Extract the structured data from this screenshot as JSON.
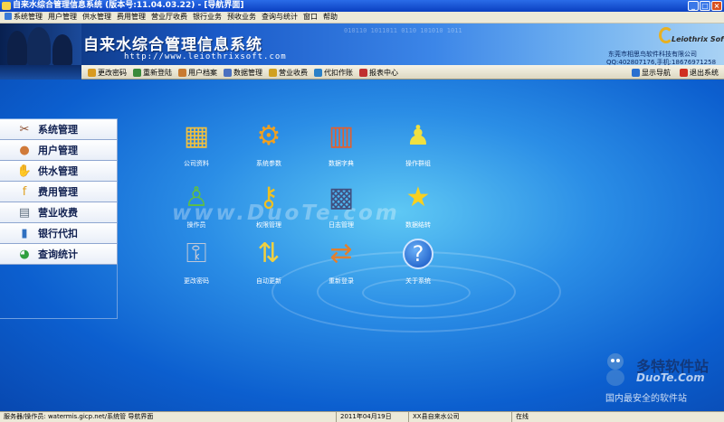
{
  "window": {
    "title": "自来水综合管理信息系统 (版本号:11.04.03.22) - [导航界面]",
    "controls": [
      "_",
      "□",
      "×"
    ]
  },
  "menu": [
    "系统管理",
    "用户管理",
    "供水管理",
    "费用管理",
    "营业厅收费",
    "银行业务",
    "预收业务",
    "查询与统计",
    "窗口",
    "帮助"
  ],
  "banner": {
    "binary_text": "010110 1011011 0110 101010 1011",
    "title": "自来水综合管理信息系统",
    "url": "http://www.leiothrixsoft.com",
    "brand_name": "Leiothrix Soft",
    "company": "东莞市相思鸟软件科技有限公司",
    "contact": "QQ:402807176,手机:18676971258"
  },
  "toolbar": {
    "items": [
      {
        "label": "更改密码",
        "icon": "key-icon",
        "color": "#d89a20"
      },
      {
        "label": "重新登陆",
        "icon": "login-icon",
        "color": "#3a8a3a"
      },
      {
        "label": "用户档案",
        "icon": "user-file-icon",
        "color": "#c87a30"
      },
      {
        "label": "数据管理",
        "icon": "database-icon",
        "color": "#4a70c0"
      },
      {
        "label": "营业收费",
        "icon": "cashier-icon",
        "color": "#d0a020"
      },
      {
        "label": "代扣作账",
        "icon": "bank-icon",
        "color": "#2a80c8"
      },
      {
        "label": "报表中心",
        "icon": "report-icon",
        "color": "#c03030"
      }
    ],
    "show_nav": "显示导航",
    "exit": "退出系统"
  },
  "sidenav": [
    {
      "label": "系统管理",
      "icon": "tools-icon",
      "glyph": "✂",
      "color": "#8a4a2a"
    },
    {
      "label": "用户管理",
      "icon": "user-icon",
      "glyph": "●",
      "color": "#d07a3a"
    },
    {
      "label": "供水管理",
      "icon": "water-supply-icon",
      "glyph": "✋",
      "color": "#c09050"
    },
    {
      "label": "费用管理",
      "icon": "fee-icon",
      "glyph": "f",
      "color": "#e0a020"
    },
    {
      "label": "营业收费",
      "icon": "cash-register-icon",
      "glyph": "▤",
      "color": "#607080"
    },
    {
      "label": "银行代扣",
      "icon": "bank-card-icon",
      "glyph": "▮",
      "color": "#3070c0"
    },
    {
      "label": "查询统计",
      "icon": "pie-chart-icon",
      "glyph": "◕",
      "color": "#30a040"
    }
  ],
  "tiles": [
    {
      "label": "公司资料",
      "icon": "company-building-icon",
      "glyph": "▦",
      "color": "#f0c040"
    },
    {
      "label": "系统参数",
      "icon": "gear-icon",
      "glyph": "⚙",
      "color": "#f0a020"
    },
    {
      "label": "数据字典",
      "icon": "books-icon",
      "glyph": "▥",
      "color": "#e06030"
    },
    {
      "label": "操作群组",
      "icon": "group-icon",
      "glyph": "♟",
      "color": "#f0e040"
    },
    {
      "label": "操作员",
      "icon": "operators-icon",
      "glyph": "♙",
      "color": "#60c040"
    },
    {
      "label": "权限管理",
      "icon": "key-icon",
      "glyph": "⚷",
      "color": "#f0c020"
    },
    {
      "label": "日志管理",
      "icon": "film-log-icon",
      "glyph": "▩",
      "color": "#405080"
    },
    {
      "label": "数据结转",
      "icon": "star-icon",
      "glyph": "★",
      "color": "#f8d020"
    },
    {
      "label": "更改密码",
      "icon": "safe-lock-icon",
      "glyph": "⚿",
      "color": "#c0c8d8"
    },
    {
      "label": "自动更新",
      "icon": "update-network-icon",
      "glyph": "⇅",
      "color": "#f0d040"
    },
    {
      "label": "重新登录",
      "icon": "relogin-icon",
      "glyph": "⇄",
      "color": "#e08030"
    },
    {
      "label": "关于系统",
      "icon": "help-icon",
      "glyph": "?",
      "color": "#ffffff"
    }
  ],
  "watermark": "www.DuoTe.com",
  "duote": {
    "name": "多特软件站",
    "site": "DuoTe.Com",
    "slogan": "国内最安全的软件站"
  },
  "status": {
    "server": "服务器/操作员: watermis.gicp.net/系统管 导航界面",
    "date": "2011年04月19日",
    "company": "XX县自来水公司",
    "state": "在线"
  }
}
